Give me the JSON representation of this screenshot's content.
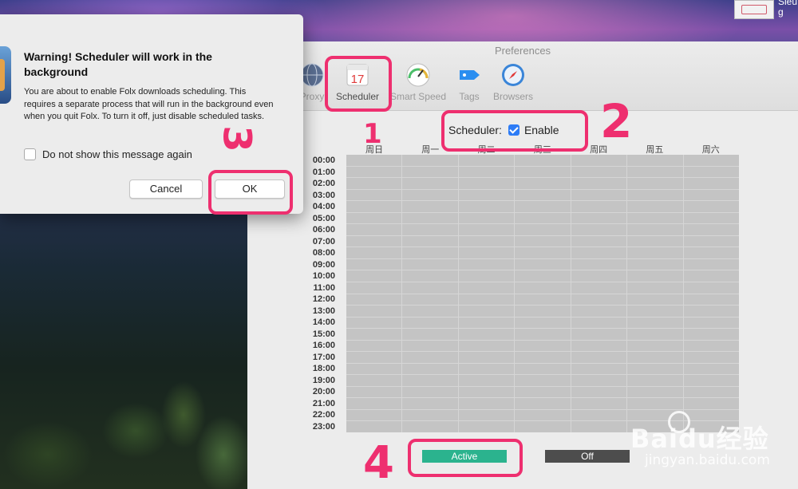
{
  "desktop": {
    "icon_label": "Sleu g"
  },
  "preferences": {
    "title": "Preferences",
    "toolbar": [
      {
        "label": "Proxy",
        "icon": "globe-icon"
      },
      {
        "label": "Scheduler",
        "icon": "calendar-icon",
        "badge": "17"
      },
      {
        "label": "Smart Speed",
        "icon": "gauge-icon"
      },
      {
        "label": "Tags",
        "icon": "tag-icon"
      },
      {
        "label": "Browsers",
        "icon": "compass-icon"
      }
    ],
    "scheduler_label": "Scheduler:",
    "enable_label": "Enable",
    "enabled": true,
    "days": [
      "周日",
      "周一",
      "周二",
      "周三",
      "周四",
      "周五",
      "周六"
    ],
    "hours": [
      "00:00",
      "01:00",
      "02:00",
      "03:00",
      "04:00",
      "05:00",
      "06:00",
      "07:00",
      "08:00",
      "09:00",
      "10:00",
      "11:00",
      "12:00",
      "13:00",
      "14:00",
      "15:00",
      "16:00",
      "17:00",
      "18:00",
      "19:00",
      "20:00",
      "21:00",
      "22:00",
      "23:00"
    ],
    "active_label": "Active",
    "off_label": "Off"
  },
  "alert": {
    "title": "Warning! Scheduler will work in the background",
    "message": "You are about to enable Folx downloads scheduling. This requires a separate process that will run in the background even when you quit Folx. To turn it off, just disable scheduled tasks.",
    "checkbox_label": "Do not show this message again",
    "checked": false,
    "cancel_label": "Cancel",
    "ok_label": "OK"
  },
  "annotations": [
    "1",
    "2",
    "3",
    "4"
  ],
  "watermark": {
    "brand": "Baidu经验",
    "url": "jingyan.baidu.com"
  },
  "colors": {
    "annotation": "#ee2f6f",
    "active": "#2bb38e",
    "off": "#4d4d4d",
    "checkbox": "#2d7cf6"
  }
}
